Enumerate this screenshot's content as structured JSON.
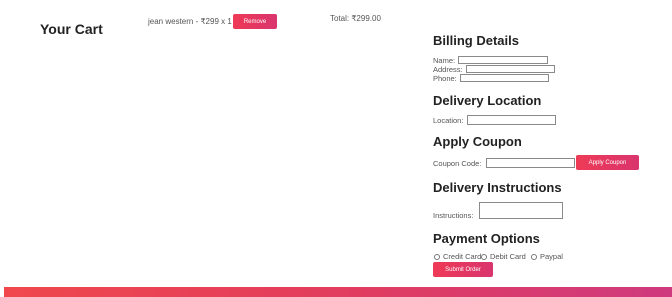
{
  "cart": {
    "title": "Your Cart",
    "item_text": "jean western - ₹299 x 1",
    "remove_label": "Remove",
    "total_text": "Total: ₹299.00"
  },
  "billing": {
    "heading": "Billing Details",
    "name_label": "Name:",
    "address_label": "Address:",
    "phone_label": "Phone:"
  },
  "delivery_location": {
    "heading": "Delivery Location",
    "location_label": "Location:"
  },
  "coupon": {
    "heading": "Apply Coupon",
    "code_label": "Coupon Code:",
    "apply_label": "Apply Coupon"
  },
  "instructions": {
    "heading": "Delivery Instructions",
    "label": "Instructions:"
  },
  "payment": {
    "heading": "Payment Options",
    "options": [
      "Credit Card",
      "Debit Card",
      "Paypal"
    ],
    "submit_label": "Submit Order"
  },
  "colors": {
    "accent_start": "#ee3a56",
    "accent_end": "#d9356e"
  }
}
